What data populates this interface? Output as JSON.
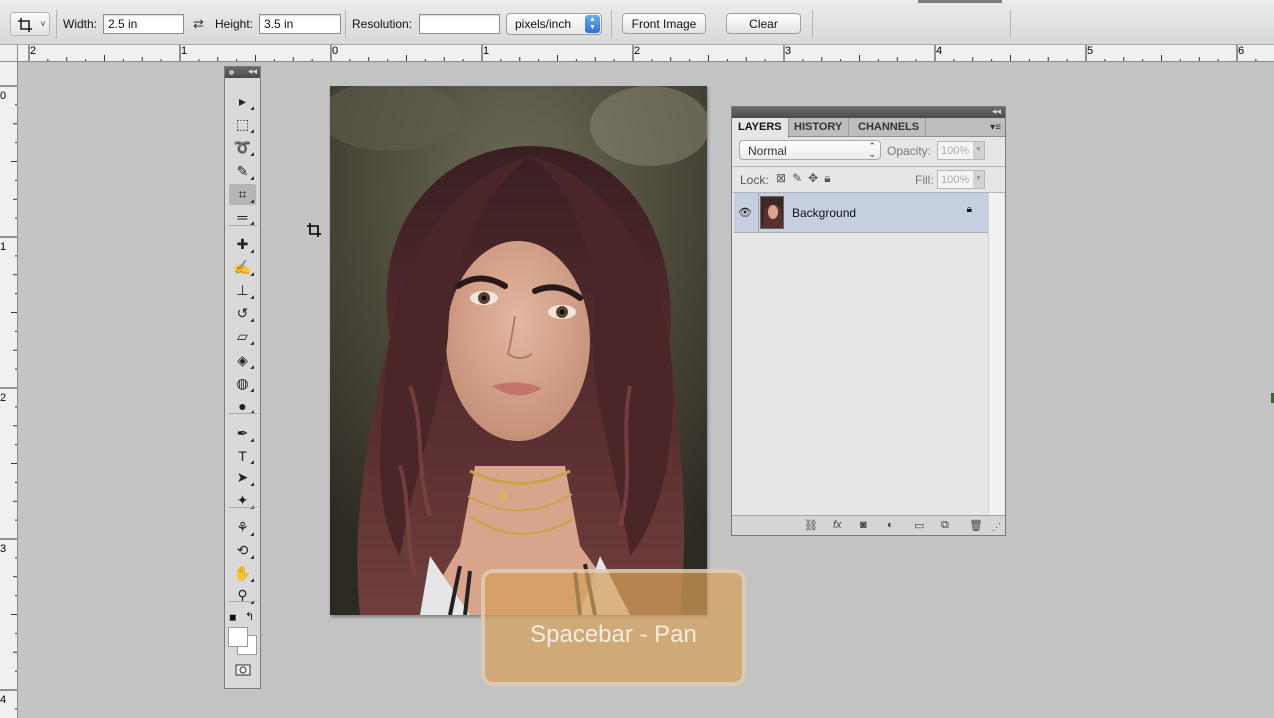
{
  "options_bar": {
    "tool_preset_icon": "crop-icon",
    "width_label": "Width:",
    "width_value": "2.5 in",
    "swap_icon": "swap-arrows-icon",
    "height_label": "Height:",
    "height_value": "3.5 in",
    "resolution_label": "Resolution:",
    "resolution_value": "",
    "resolution_unit": "pixels/inch",
    "front_image_label": "Front Image",
    "clear_label": "Clear"
  },
  "rulers": {
    "horizontal_labels": [
      "2",
      "1",
      "0",
      "1",
      "2",
      "3",
      "4",
      "5",
      "6"
    ],
    "vertical_labels": [
      "0",
      "1",
      "2",
      "3",
      "4"
    ]
  },
  "toolbox": {
    "tools": [
      {
        "name": "move-tool-icon",
        "glyph": "▸"
      },
      {
        "name": "marquee-tool-icon",
        "glyph": "⬚"
      },
      {
        "name": "lasso-tool-icon",
        "glyph": "➰"
      },
      {
        "name": "quick-selection-tool-icon",
        "glyph": "✎"
      },
      {
        "name": "crop-tool-icon",
        "glyph": "⌗"
      },
      {
        "name": "ruler-tool-icon",
        "glyph": "═"
      },
      {
        "name": "healing-brush-tool-icon",
        "glyph": "✚"
      },
      {
        "name": "brush-tool-icon",
        "glyph": "✍"
      },
      {
        "name": "clone-stamp-tool-icon",
        "glyph": "⊥"
      },
      {
        "name": "history-brush-tool-icon",
        "glyph": "↺"
      },
      {
        "name": "eraser-tool-icon",
        "glyph": "▱"
      },
      {
        "name": "paint-bucket-tool-icon",
        "glyph": "◈"
      },
      {
        "name": "blur-tool-icon",
        "glyph": "◍"
      },
      {
        "name": "dodge-tool-icon",
        "glyph": "●"
      },
      {
        "name": "pen-tool-icon",
        "glyph": "✒"
      },
      {
        "name": "type-tool-icon",
        "glyph": "T"
      },
      {
        "name": "path-selection-tool-icon",
        "glyph": "➤"
      },
      {
        "name": "custom-shape-tool-icon",
        "glyph": "✦"
      },
      {
        "name": "3d-rotate-tool-icon",
        "glyph": "⚘"
      },
      {
        "name": "3d-orbit-tool-icon",
        "glyph": "⟲"
      },
      {
        "name": "hand-tool-icon",
        "glyph": "✋"
      },
      {
        "name": "zoom-tool-icon",
        "glyph": "⚲"
      }
    ],
    "quick_mask_icon": "quick-mask-icon"
  },
  "layers_panel": {
    "tabs": [
      {
        "label": "LAYERS",
        "active": true
      },
      {
        "label": "HISTORY",
        "active": false
      },
      {
        "label": "CHANNELS",
        "active": false
      }
    ],
    "blend_mode": "Normal",
    "opacity_label": "Opacity:",
    "opacity_value": "100%",
    "lock_label": "Lock:",
    "fill_label": "Fill:",
    "fill_value": "100%",
    "layers": [
      {
        "name": "Background",
        "visible": true,
        "locked": true
      }
    ],
    "footer_icons": [
      "link-layers-icon",
      "fx-icon",
      "add-mask-icon",
      "adjustment-layer-icon",
      "new-group-icon",
      "new-layer-icon",
      "delete-layer-icon"
    ]
  },
  "hud": {
    "text": "Spacebar - Pan"
  },
  "colors": {
    "workspace_bg": "#c3c3c3",
    "layer_selected": "#c6cfe0",
    "hud_fill": "#d4a05a"
  }
}
